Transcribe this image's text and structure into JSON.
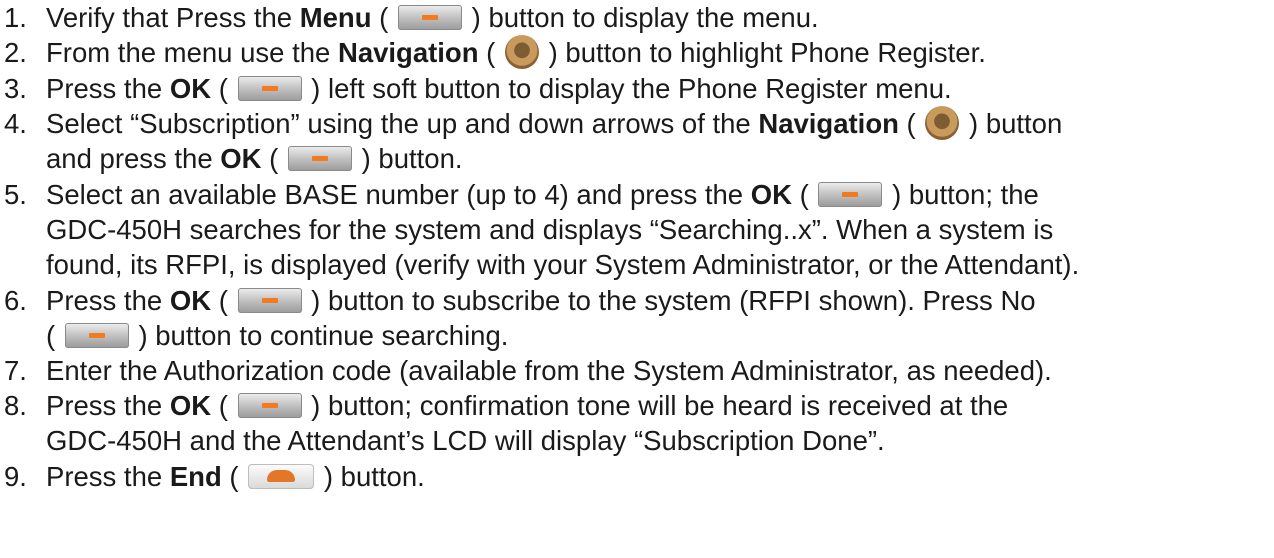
{
  "steps": [
    {
      "num": "1.",
      "lines": [
        {
          "a": "Verify that Press the ",
          "b": "Menu",
          "c": " (",
          "d": ") button to display the menu.",
          "icon": "softkey-icon"
        }
      ]
    },
    {
      "num": "2.",
      "lines": [
        {
          "a": "From the menu use the ",
          "b": "Navigation",
          "c": " (",
          "d": ") button to highlight Phone Register.",
          "icon": "navigation-icon"
        }
      ]
    },
    {
      "num": "3.",
      "lines": [
        {
          "a": "Press the ",
          "b": "OK",
          "c": " (",
          "d": ") left soft button to display the Phone Register menu.",
          "icon": "softkey-icon"
        }
      ]
    },
    {
      "num": "4.",
      "lines": [
        {
          "a": "Select “Subscription” using the up and down arrows of the ",
          "b": "Navigation",
          "c": " (",
          "d": ") button",
          "icon": "navigation-icon"
        },
        {
          "a": "and press the ",
          "b": "OK",
          "c": " (",
          "d": ") button.",
          "icon": "softkey-icon"
        }
      ]
    },
    {
      "num": "5.",
      "lines": [
        {
          "a": "Select an available BASE number (up to 4) and press the ",
          "b": "OK",
          "c": " (",
          "d": ") button; the",
          "icon": "softkey-icon"
        },
        {
          "text": "GDC-450H searches for the system and displays “Searching..x”.  When a system is"
        },
        {
          "text": "found, its RFPI, is displayed (verify with your System Administrator, or the Attendant)."
        }
      ]
    },
    {
      "num": "6.",
      "lines": [
        {
          "a": "Press the ",
          "b": "OK",
          "c": " (",
          "d": ") button to subscribe to the system (RFPI shown). Press No",
          "icon": "softkey-icon"
        },
        {
          "a": "",
          "b": "",
          "c": "(",
          "d": ") button to continue searching.",
          "icon": "softkey-icon"
        }
      ]
    },
    {
      "num": "7.",
      "lines": [
        {
          "text": "Enter the Authorization code (available from the System Administrator, as needed)."
        }
      ]
    },
    {
      "num": "8.",
      "lines": [
        {
          "a": "Press the ",
          "b": "OK",
          "c": " (",
          "d": ") button; confirmation tone will be heard is received at the",
          "icon": "softkey-icon"
        },
        {
          "text": "GDC-450H and the Attendant’s LCD will display “Subscription Done”."
        }
      ]
    },
    {
      "num": "9.",
      "lines": [
        {
          "a": "Press the ",
          "b": "End",
          "c": " (",
          "d": ") button.",
          "icon": "end-call-icon"
        }
      ]
    }
  ]
}
